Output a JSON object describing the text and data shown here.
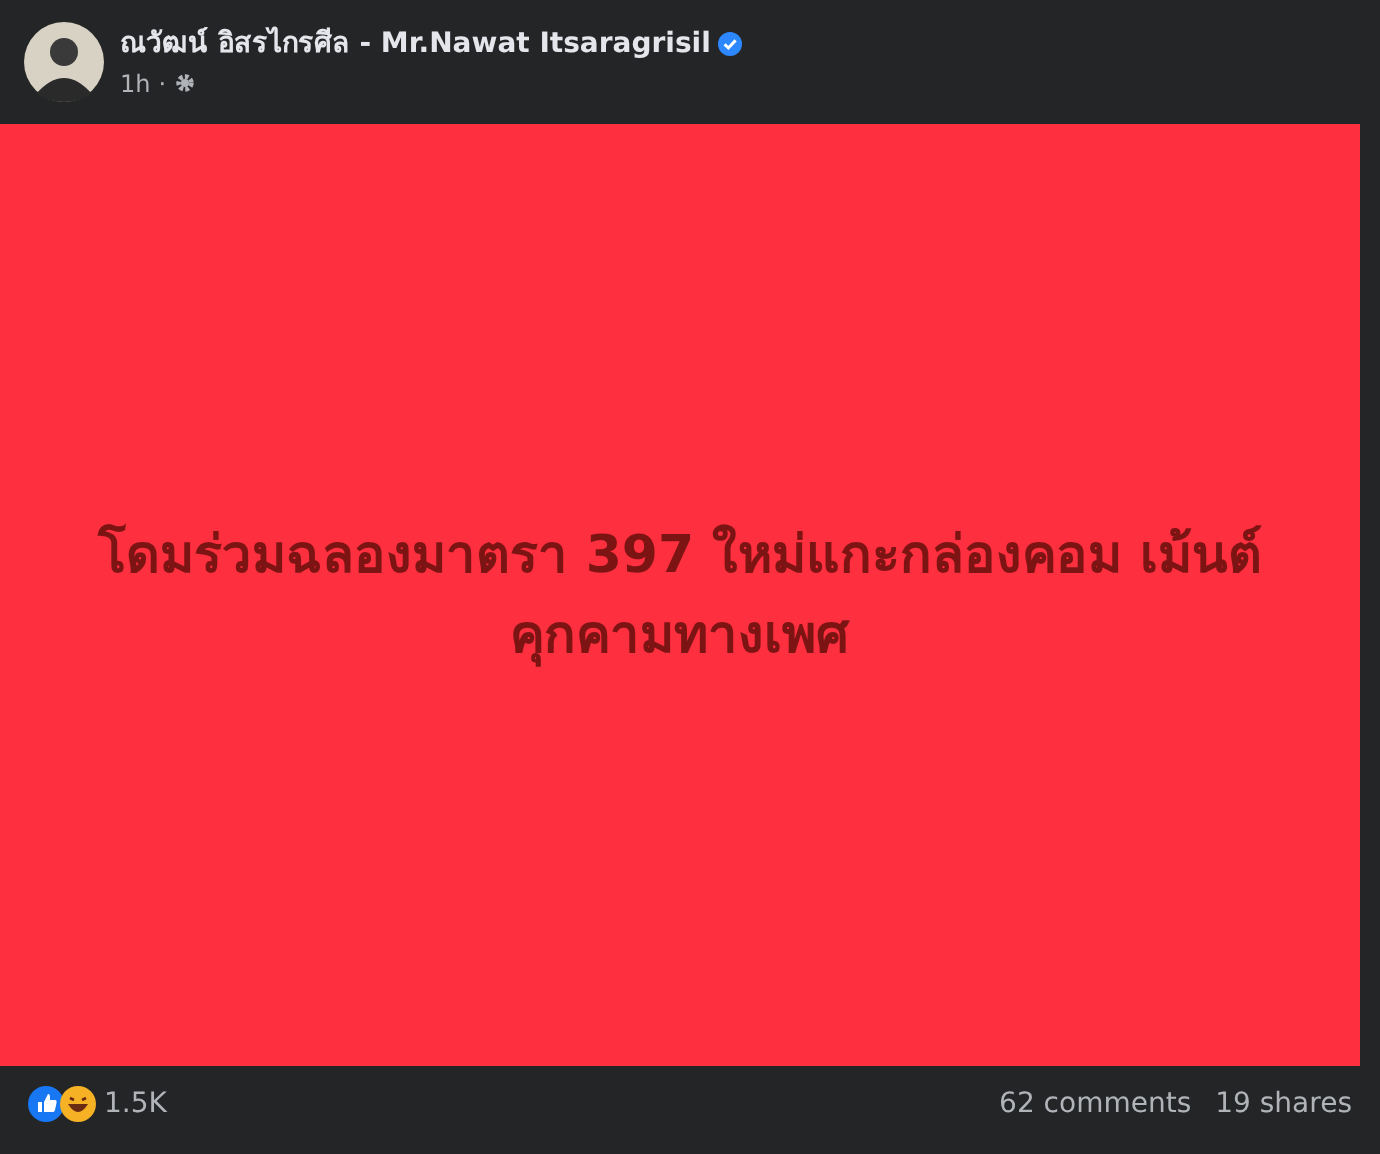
{
  "post": {
    "author": "ณวัฒน์ อิสรไกรศีล - Mr.Nawat Itsaragrisil",
    "verified": true,
    "time": "1h",
    "dot": "·"
  },
  "image": {
    "headline": "โดมร่วมฉลองมาตรา 397 ใหม่แกะกล่องคอม เม้นต์คุกคามทางเพศ"
  },
  "footer": {
    "reactions": "1.5K",
    "comments": "62 comments",
    "shares": "19 shares"
  }
}
